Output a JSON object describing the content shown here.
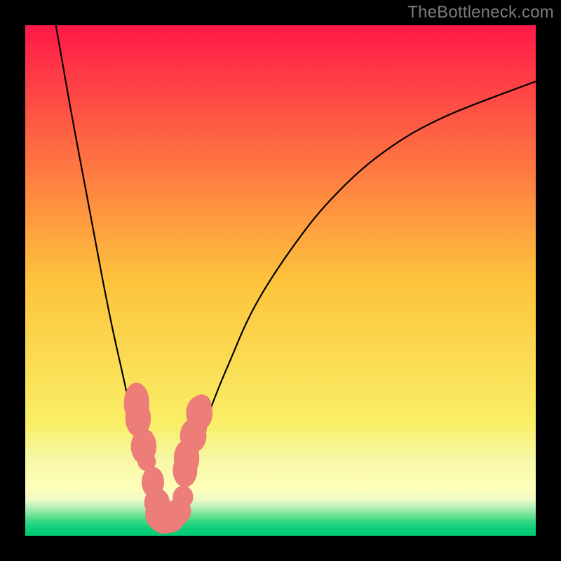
{
  "watermark": "TheBottleneck.com",
  "colors": {
    "frame_bg": "#000000",
    "watermark_text": "#7a7a7a",
    "data_marker": "#ec7d79",
    "curve_stroke": "#000000",
    "gradient_stops": [
      {
        "offset": 0.0,
        "color": "#ff1948"
      },
      {
        "offset": 0.5,
        "color": "#fdc33c"
      },
      {
        "offset": 0.78,
        "color": "#f9ef66"
      },
      {
        "offset": 0.85,
        "color": "#f6f7a5"
      },
      {
        "offset": 0.905,
        "color": "#ffffb9"
      },
      {
        "offset": 0.93,
        "color": "#eefac4"
      },
      {
        "offset": 0.94,
        "color": "#c5f3bf"
      },
      {
        "offset": 0.95,
        "color": "#9eeba9"
      },
      {
        "offset": 0.96,
        "color": "#6ce294"
      },
      {
        "offset": 0.972,
        "color": "#35d885"
      },
      {
        "offset": 0.985,
        "color": "#0fd07a"
      },
      {
        "offset": 1.0,
        "color": "#00c973"
      }
    ]
  },
  "chart_data": {
    "type": "line",
    "title": "",
    "xlabel": "",
    "ylabel": "",
    "xlim": [
      0,
      100
    ],
    "ylim": [
      0,
      100
    ],
    "grid": false,
    "legend": false,
    "series": [
      {
        "name": "bottleneck-curve-left",
        "x": [
          6,
          9,
          12,
          15,
          17,
          19,
          21,
          23,
          24,
          25,
          26,
          27,
          28
        ],
        "y": [
          100,
          83,
          67,
          51,
          41,
          32,
          23,
          15,
          11,
          8,
          5,
          3,
          2
        ]
      },
      {
        "name": "bottleneck-curve-right",
        "x": [
          28,
          30,
          33,
          36,
          40,
          45,
          52,
          60,
          70,
          82,
          100
        ],
        "y": [
          2,
          5,
          14,
          24,
          34,
          45,
          56,
          66,
          75,
          82,
          89
        ]
      }
    ],
    "data_points": {
      "name": "samples",
      "x": [
        21.8,
        22.1,
        23.2,
        23.8,
        25.0,
        25.8,
        26.3,
        27.3,
        27.3,
        28.2,
        29.6,
        30.0,
        30.9,
        31.3,
        31.6,
        32.9,
        33.3,
        34.1,
        34.5
      ],
      "y": [
        26.0,
        23.0,
        17.5,
        14.5,
        10.5,
        6.5,
        4.2,
        2.4,
        2.1,
        2.3,
        3.7,
        4.8,
        7.6,
        12.8,
        15.2,
        19.6,
        21.0,
        24.0,
        25.5
      ],
      "rx": [
        2.5,
        2.5,
        2.5,
        1.8,
        2.2,
        2.5,
        2.8,
        3.0,
        2.5,
        2.6,
        2.3,
        2.5,
        2.0,
        2.4,
        2.5,
        2.6,
        2.3,
        2.6,
        2.0
      ],
      "ry": [
        4.0,
        3.6,
        3.5,
        1.8,
        3.0,
        2.8,
        3.2,
        1.7,
        1.7,
        1.7,
        1.9,
        2.5,
        2.2,
        3.3,
        3.6,
        3.3,
        2.0,
        3.4,
        2.2
      ]
    }
  }
}
